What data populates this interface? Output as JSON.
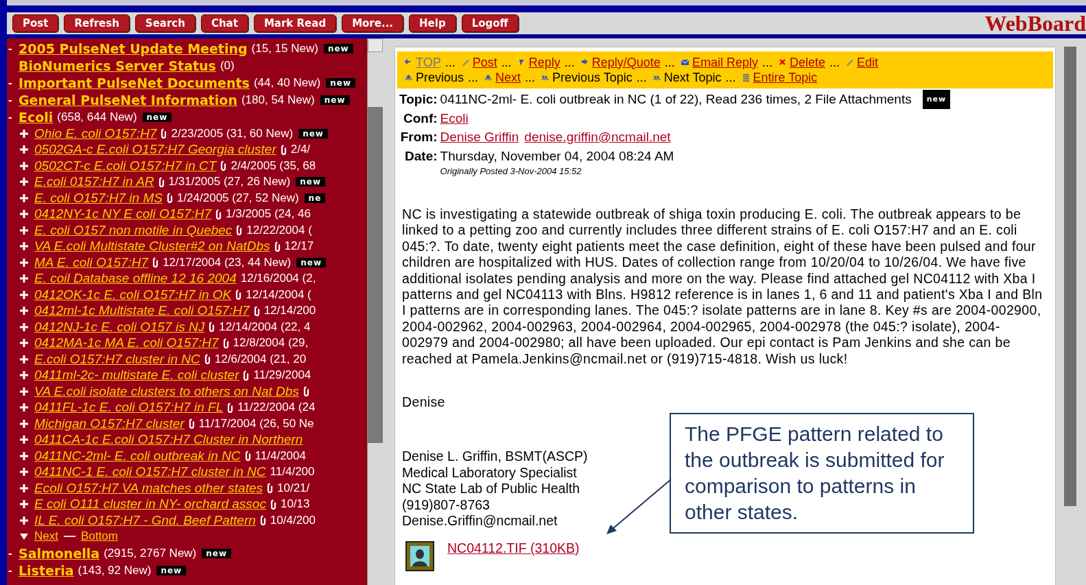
{
  "toolbar": {
    "buttons": [
      "Post",
      "Refresh",
      "Search",
      "Chat",
      "Mark Read",
      "More...",
      "Help",
      "Logoff"
    ],
    "logo": "WebBoard"
  },
  "conferences": [
    {
      "name": "2005 PulseNet Update Meeting",
      "count": "(15, 15 New)",
      "badge": "new",
      "bullet": "-"
    },
    {
      "name": "BioNumerics Server Status",
      "count": "(0)"
    },
    {
      "name": "Important PulseNet Documents",
      "count": "(44, 40 New)",
      "badge": "new",
      "bullet": "-"
    },
    {
      "name": "General PulseNet Information",
      "count": "(180, 54 New)",
      "badge": "new",
      "bullet": "-"
    },
    {
      "name": "Ecoli",
      "count": "(658, 644 New)",
      "badge": "new",
      "bullet": "-",
      "topics": [
        {
          "title": "Ohio E. coli O157:H7",
          "attachment": true,
          "info": "2/23/2005 (31, 60 New)",
          "badge": "new"
        },
        {
          "title": "0502GA-c E.coli O157:H7 Georgia cluster",
          "attachment": true,
          "info": "2/4/"
        },
        {
          "title": "0502CT-c E.coli O157:H7 in CT",
          "attachment": true,
          "info": "2/4/2005 (35, 68"
        },
        {
          "title": "E.coli 0157:H7 in AR",
          "attachment": true,
          "info": "1/31/2005 (27, 26 New)",
          "badge": "new"
        },
        {
          "title": "E. coli O157:H7 in MS",
          "attachment": true,
          "info": "1/24/2005 (27, 52 New)",
          "badge": "ne"
        },
        {
          "title": "0412NY-1c NY E coli O157:H7",
          "attachment": true,
          "info": "1/3/2005 (24, 46"
        },
        {
          "title": "E. coli O157 non motile in Quebec",
          "attachment": true,
          "info": "12/22/2004 ("
        },
        {
          "title": "VA E.coli Multistate Cluster#2 on NatDbs",
          "attachment": true,
          "info": "12/17"
        },
        {
          "title": "MA E. coli O157:H7",
          "attachment": true,
          "info": "12/17/2004 (23, 44 New)",
          "badge": "new"
        },
        {
          "title": "E. coil Database offline 12 16 2004",
          "attachment": false,
          "info": "12/16/2004 (2,"
        },
        {
          "title": "0412OK-1c E. coli O157:H7 in OK",
          "attachment": true,
          "info": "12/14/2004 ("
        },
        {
          "title": "0412ml-1c Multistate E. coli O157:H7",
          "attachment": true,
          "info": "12/14/200"
        },
        {
          "title": "0412NJ-1c E. coli O157 is NJ",
          "attachment": true,
          "info": "12/14/2004 (22, 4"
        },
        {
          "title": "0412MA-1c MA E. coli O157:H7",
          "attachment": true,
          "info": "12/8/2004 (29,"
        },
        {
          "title": "E.coli O157:H7 cluster in NC",
          "attachment": true,
          "info": "12/6/2004 (21, 20"
        },
        {
          "title": "0411ml-2c- multistate E. coli cluster",
          "attachment": true,
          "info": "11/29/2004"
        },
        {
          "title": "VA E.coli isolate clusters to others on Nat Dbs",
          "attachment": true
        },
        {
          "title": "0411FL-1c E. coli O157:H7 in FL",
          "attachment": true,
          "info": "11/22/2004 (24"
        },
        {
          "title": "Michigan O157:H7 cluster",
          "attachment": true,
          "info": "11/17/2004 (26, 50 Ne"
        },
        {
          "title": "0411CA-1c E.coli O157:H7 Cluster in Northern",
          "attachment": false
        },
        {
          "title": "0411NC-2ml- E. coli outbreak in NC",
          "attachment": true,
          "info": "11/4/2004"
        },
        {
          "title": "0411NC-1 E. coli O157:H7 cluster in NC",
          "attachment": false,
          "info": "11/4/200"
        },
        {
          "title": "Ecoli O157:H7 VA matches other states",
          "attachment": true,
          "info": "10/21/"
        },
        {
          "title": "E coli O111 cluster in NY- orchard assoc",
          "attachment": true,
          "info": "10/13"
        },
        {
          "title": "IL E. coli O157:H7 - Gnd. Beef Pattern",
          "attachment": true,
          "info": "10/4/200"
        }
      ],
      "pager": {
        "next": "Next",
        "separator": "—",
        "bottom": "Bottom"
      }
    },
    {
      "name": "Salmonella",
      "count": "(2915, 2767 New)",
      "badge": "new",
      "bullet": "-"
    },
    {
      "name": "Listeria",
      "count": "(143, 92 New)",
      "badge": "new",
      "bullet": "-"
    }
  ],
  "nav": [
    [
      {
        "label": "TOP",
        "kind": "visited",
        "after": "..."
      },
      {
        "label": "Post",
        "kind": "link",
        "after": "..."
      },
      {
        "label": "Reply",
        "kind": "link",
        "after": "..."
      },
      {
        "label": "Reply/Quote",
        "kind": "link",
        "after": "..."
      },
      {
        "label": "Email Reply",
        "kind": "link",
        "after": "..."
      },
      {
        "label": "Delete",
        "kind": "link",
        "after": "..."
      },
      {
        "label": "Edit",
        "kind": "link"
      }
    ],
    [
      {
        "label": "Previous",
        "kind": "plain",
        "after": "..."
      },
      {
        "label": "Next",
        "kind": "link",
        "after": "..."
      },
      {
        "label": "Previous Topic",
        "kind": "plain",
        "after": "..."
      },
      {
        "label": "Next Topic",
        "kind": "plain",
        "after": "..."
      },
      {
        "label": "Entire Topic",
        "kind": "link"
      }
    ]
  ],
  "header": [
    {
      "label": "Topic:",
      "parts": [
        {
          "text": "0411NC-2ml- E. coli outbreak in NC (1 of 22), Read 236 times, 2 File Attachments",
          "kind": "plain"
        },
        {
          "text": "new",
          "kind": "badge"
        }
      ]
    },
    {
      "label": "Conf:",
      "parts": [
        {
          "text": "Ecoli",
          "kind": "link"
        }
      ]
    },
    {
      "label": "From:",
      "parts": [
        {
          "text": "Denise Griffin",
          "kind": "link"
        },
        {
          "text": "denise.griffin@ncmail.net",
          "kind": "link"
        }
      ]
    },
    {
      "label": "Date:",
      "parts": [
        {
          "text": "Thursday, November 04, 2004 08:24 AM",
          "kind": "plain"
        }
      ]
    }
  ],
  "originally_posted": "Originally Posted 3-Nov-2004 15:52",
  "body": "NC is investigating a statewide outbreak of shiga toxin producing E. coli. The outbreak appears to be linked to a petting zoo and currently includes three different strains of E. coli O157:H7 and an E. coli 045:?. To date, twenty eight patients meet the case definition, eight of these have been pulsed and four children are hospitalized with HUS. Dates of collection range from 10/20/04 to 10/26/04. We have five additional isolates pending analysis and more on the way. Please find attached gel NC04112 with Xba I patterns and gel NC04113 with Blns. H9812 reference is in lanes 1, 6 and 11 and patient's Xba I and Bln I patterns are in corresponding lanes. The 045:? isolate patterns are in lane 8. Key #s are 2004-002900, 2004-002962, 2004-002963, 2004-002964, 2004-002965, 2004-002978 (the 045:? isolate), 2004-002979 and 2004-002980; all have been uploaded. Our epi contact is Pam Jenkins and she can be reached at Pamela.Jenkins@ncmail.net or (919)715-4818. Wish us luck!",
  "greeting": "Denise",
  "signature": [
    "Denise L. Griffin, BSMT(ASCP)",
    "Medical Laboratory Specialist",
    "NC State Lab of Public Health",
    "(919)807-8763",
    "Denise.Griffin@ncmail.net"
  ],
  "attachment": "NC04112.TIF (310KB)",
  "callout": "The PFGE pattern related to the outbreak is submitted for comparison to patterns in other states."
}
